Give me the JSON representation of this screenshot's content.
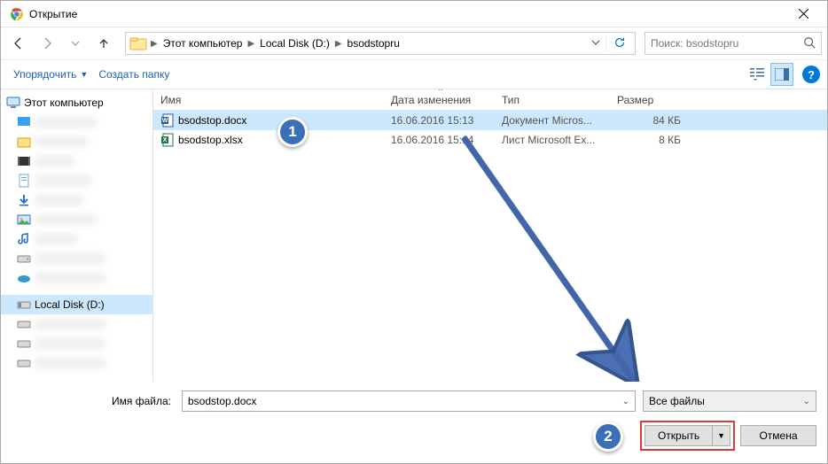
{
  "window": {
    "title": "Открытие"
  },
  "breadcrumb": {
    "items": [
      "Этот компьютер",
      "Local Disk (D:)",
      "bsodstopru"
    ]
  },
  "search": {
    "placeholder": "Поиск: bsodstopru"
  },
  "toolbar": {
    "organize": "Упорядочить",
    "newfolder": "Создать папку"
  },
  "sidebar": {
    "root": "Этот компьютер",
    "disk": "Local Disk (D:)"
  },
  "columns": {
    "name": "Имя",
    "date": "Дата изменения",
    "type": "Тип",
    "size": "Размер"
  },
  "files": [
    {
      "name": "bsodstop.docx",
      "date": "16.06.2016 15:13",
      "type": "Документ Micros...",
      "size": "84 КБ",
      "kind": "docx",
      "selected": true
    },
    {
      "name": "bsodstop.xlsx",
      "date": "16.06.2016 15:14",
      "type": "Лист Microsoft Ex...",
      "size": "8 КБ",
      "kind": "xlsx",
      "selected": false
    }
  ],
  "footer": {
    "filename_label": "Имя файла:",
    "filename_value": "bsodstop.docx",
    "filter": "Все файлы",
    "open": "Открыть",
    "cancel": "Отмена"
  },
  "annotations": {
    "one": "1",
    "two": "2"
  }
}
